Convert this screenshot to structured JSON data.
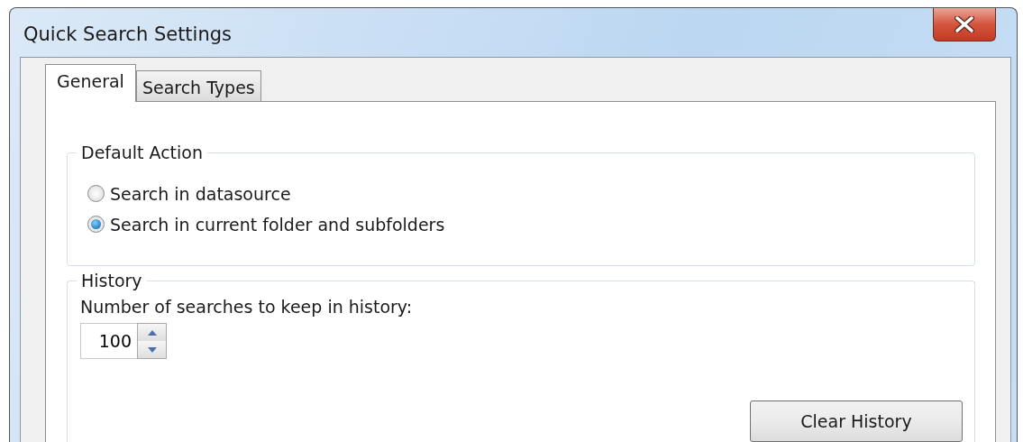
{
  "window": {
    "title": "Quick Search Settings"
  },
  "tabs": [
    {
      "label": "General",
      "selected": true
    },
    {
      "label": "Search Types",
      "selected": false
    }
  ],
  "default_action": {
    "title": "Default Action",
    "options": [
      {
        "label": "Search in datasource",
        "selected": false
      },
      {
        "label": "Search in current folder and subfolders",
        "selected": true
      }
    ]
  },
  "history": {
    "title": "History",
    "label": "Number of searches to keep in history:",
    "value": "100",
    "button": "Clear History"
  }
}
